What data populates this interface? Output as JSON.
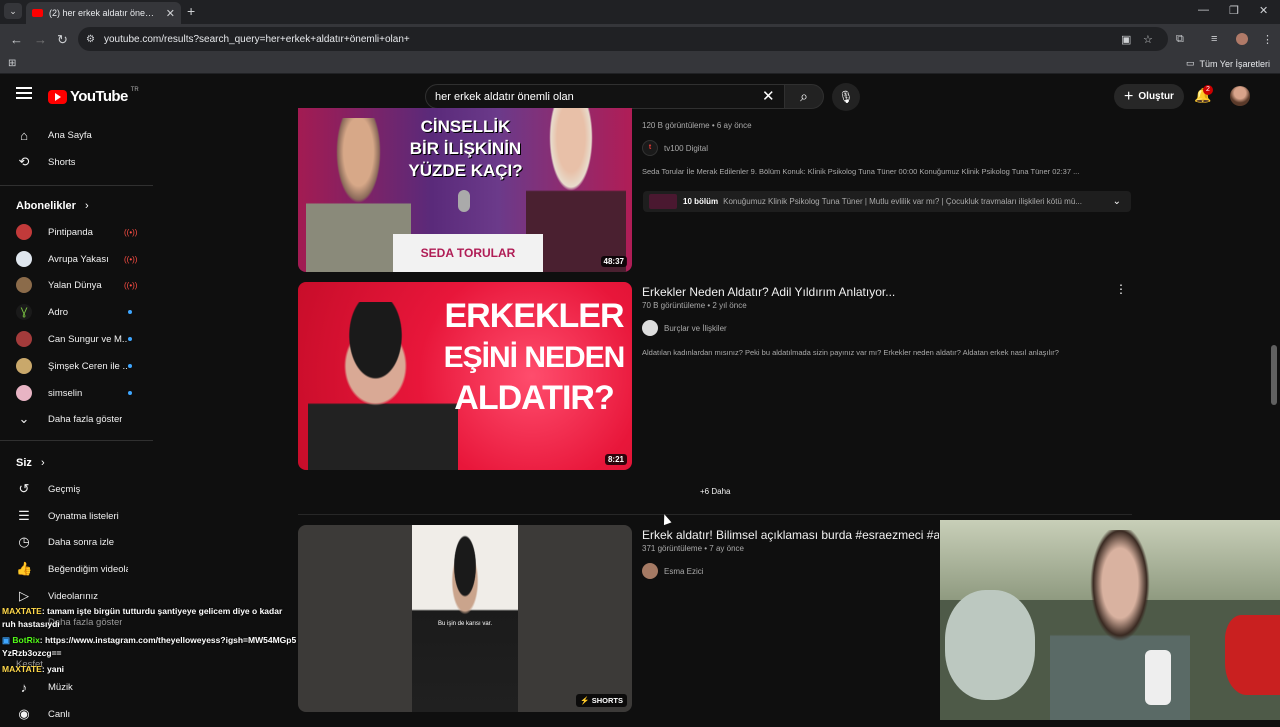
{
  "browser": {
    "tab_title": "(2) her erkek aldatır önemli olan",
    "url": "youtube.com/results?search_query=her+erkek+aldatır+önemli+olan+",
    "bookmarks_label": "Tüm Yer İşaretleri"
  },
  "header": {
    "logo": "YouTube",
    "region": "TR",
    "search_value": "her erkek aldatır önemli olan",
    "create_label": "Oluştur",
    "notifications": "2"
  },
  "sidebar": {
    "main": [
      {
        "label": "Ana Sayfa",
        "icon": "home-icon"
      },
      {
        "label": "Shorts",
        "icon": "shorts-icon"
      }
    ],
    "subs_title": "Abonelikler",
    "subs": [
      {
        "label": "Pintipanda",
        "status": "live",
        "color": "#c23a3a"
      },
      {
        "label": "Avrupa Yakası",
        "status": "live",
        "color": "#dfe6ee"
      },
      {
        "label": "Yalan Dünya",
        "status": "live",
        "color": "#8b6b4a"
      },
      {
        "label": "Adro",
        "status": "new",
        "color": "#7ac142"
      },
      {
        "label": "Can Sungur ve M...",
        "status": "new",
        "color": "#a33b3b"
      },
      {
        "label": "Şimşek Ceren ile ...",
        "status": "new",
        "color": "#c9a86b"
      },
      {
        "label": "simselin",
        "status": "new",
        "color": "#e8b4c4"
      }
    ],
    "show_more": "Daha fazla göster",
    "you_title": "Siz",
    "you": [
      {
        "label": "Geçmiş",
        "icon": "history-icon"
      },
      {
        "label": "Oynatma listeleri",
        "icon": "playlist-icon"
      },
      {
        "label": "Daha sonra izle",
        "icon": "clock-icon"
      },
      {
        "label": "Beğendiğim videolar",
        "icon": "like-icon"
      },
      {
        "label": "Videolarınız",
        "icon": "video-icon"
      },
      {
        "label": "Daha fazla göster",
        "icon": "chevron-down-icon"
      },
      {
        "label": "Keşfet",
        "icon": "explore-icon"
      },
      {
        "label": "Müzik",
        "icon": "music-icon"
      },
      {
        "label": "Canlı",
        "icon": "live-icon"
      }
    ]
  },
  "results": [
    {
      "thumb_text": [
        "CİNSELLİK",
        "BİR İLİŞKİNİN",
        "YÜZDE KAÇI?"
      ],
      "thumb_sub": "SEDA TORULAR",
      "duration": "48:37",
      "meta": "120 B görüntüleme • 6 ay önce",
      "channel": "tv100 Digital",
      "desc": "Seda Torular İle Merak Edilenler 9. Bölüm Konuk: Klinik Psikolog Tuna Tüner 00:00 Konuğumuz Klinik Psikolog Tuna Tüner 02:37 ...",
      "chapters_count": "10 bölüm",
      "chapters_text": "Konuğumuz Klinik Psikolog Tuna Tüner | Mutlu evlilik var mı? | Çocukluk travmaları ilişkileri kötü mü..."
    },
    {
      "thumb_text": [
        "ERKEKLER",
        "EŞİNİ NEDEN",
        "ALDATIR?"
      ],
      "duration": "8:21",
      "title": "Erkekler Neden Aldatır? Adil Yıldırım Anlatıyor...",
      "meta": "70 B görüntüleme • 2 yıl önce",
      "channel": "Burçlar ve İlişkiler",
      "desc": "Aldatılan kadınlardan mısınız? Peki bu aldatılmada sizin payınız var mı? Erkekler neden aldatır? Aldatan erkek nasıl anlaşılır?"
    },
    {
      "duration": "SHORTS",
      "caption": "Bu işin de karısı var.",
      "title": "Erkek aldatır! Bilimsel açıklaması burda #esraezmeci #a",
      "meta": "371 görüntüleme • 7 ay önce",
      "channel": "Esma Ezici"
    }
  ],
  "more_label": "+6 Daha",
  "chat": [
    {
      "user": "MAXTATE",
      "msg": ": tamam işte birgün tutturdu şantiyeye gelicem diye o kadar ruh hastasıydı"
    },
    {
      "user": "BotRix",
      "msg": ": https://www.instagram.com/theyelloweyess?igsh=MW54MGp5YzRzb3ozcg=="
    },
    {
      "user": "MAXTATE",
      "msg": ": yani"
    }
  ],
  "colors": {
    "accent": "#ff0000",
    "bg": "#0f0f0f",
    "live": "#ff4e45",
    "new_dot": "#3ea6ff"
  }
}
